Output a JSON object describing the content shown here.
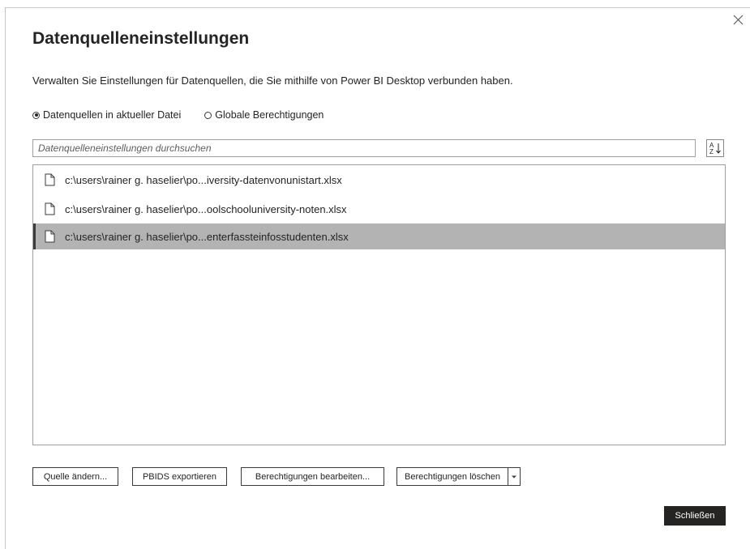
{
  "dialog": {
    "title": "Datenquelleneinstellungen",
    "subtitle": "Verwalten Sie Einstellungen für Datenquellen, die Sie mithilfe von Power BI Desktop verbunden haben.",
    "close_icon": "close-icon"
  },
  "scope": {
    "options": [
      {
        "label": "Datenquellen in aktueller Datei",
        "checked": true
      },
      {
        "label": "Globale Berechtigungen",
        "checked": false
      }
    ]
  },
  "search": {
    "placeholder": "Datenquelleneinstellungen durchsuchen",
    "value": ""
  },
  "sort": {
    "icon": "sort-ascending-icon"
  },
  "sources": {
    "items": [
      {
        "label": "c:\\users\\rainer g. haselier\\po...iversity-datenvonunistart.xlsx",
        "selected": false,
        "icon": "file-icon"
      },
      {
        "label": "c:\\users\\rainer g. haselier\\po...oolschooluniversity-noten.xlsx",
        "selected": false,
        "icon": "file-icon"
      },
      {
        "label": "c:\\users\\rainer g. haselier\\po...enterfassteinfosstudenten.xlsx",
        "selected": true,
        "icon": "file-icon"
      }
    ]
  },
  "actions": {
    "change_source": "Quelle ändern...",
    "export_pbids": "PBIDS exportieren",
    "edit_permissions": "Berechtigungen bearbeiten...",
    "clear_permissions": "Berechtigungen löschen",
    "dropdown_icon": "chevron-down-icon"
  },
  "footer": {
    "close_label": "Schließen"
  },
  "colors": {
    "selected_row": "#b3b3b3",
    "primary_button": "#252423",
    "text": "#252423"
  }
}
